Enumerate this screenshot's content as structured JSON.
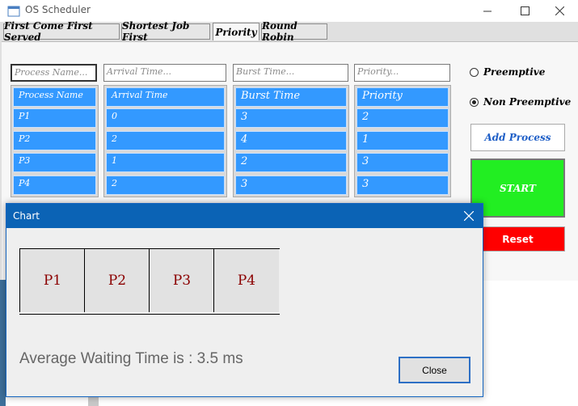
{
  "window": {
    "title": "OS Scheduler"
  },
  "tabs": [
    {
      "label": "First Come First Served"
    },
    {
      "label": "Shortest Job First"
    },
    {
      "label": "Priority"
    },
    {
      "label": "Round Robin"
    }
  ],
  "active_tab": "Priority",
  "inputs": {
    "process_name_placeholder": "Process Name...",
    "arrival_time_placeholder": "Arrival Time...",
    "burst_time_placeholder": "Burst Time...",
    "priority_placeholder": "Priority..."
  },
  "table": {
    "headers": {
      "name": "Process Name",
      "arrival": "Arrival Time",
      "burst": "Burst Time",
      "priority": "Priority"
    },
    "rows": [
      {
        "name": "P1",
        "arrival": "0",
        "burst": "3",
        "priority": "2"
      },
      {
        "name": "P2",
        "arrival": "2",
        "burst": "4",
        "priority": "1"
      },
      {
        "name": "P3",
        "arrival": "1",
        "burst": "2",
        "priority": "3"
      },
      {
        "name": "P4",
        "arrival": "2",
        "burst": "3",
        "priority": "3"
      }
    ]
  },
  "options": {
    "preemptive_label": "Preemptive",
    "non_preemptive_label": "Non Preemptive",
    "selected": "Non Preemptive"
  },
  "buttons": {
    "add_process": "Add Process",
    "start": "START",
    "reset": "Reset"
  },
  "chart_dialog": {
    "title": "Chart",
    "gantt": [
      "P1",
      "P2",
      "P3",
      "P4"
    ],
    "average_waiting_text": "Average Waiting Time is : 3.5 ms",
    "close_label": "Close"
  },
  "colors": {
    "cell_blue": "#3399ff",
    "start_green": "#22ee22",
    "reset_red": "#ff0000",
    "dialog_titlebar": "#0b63b5",
    "gantt_text": "#8b0000"
  }
}
